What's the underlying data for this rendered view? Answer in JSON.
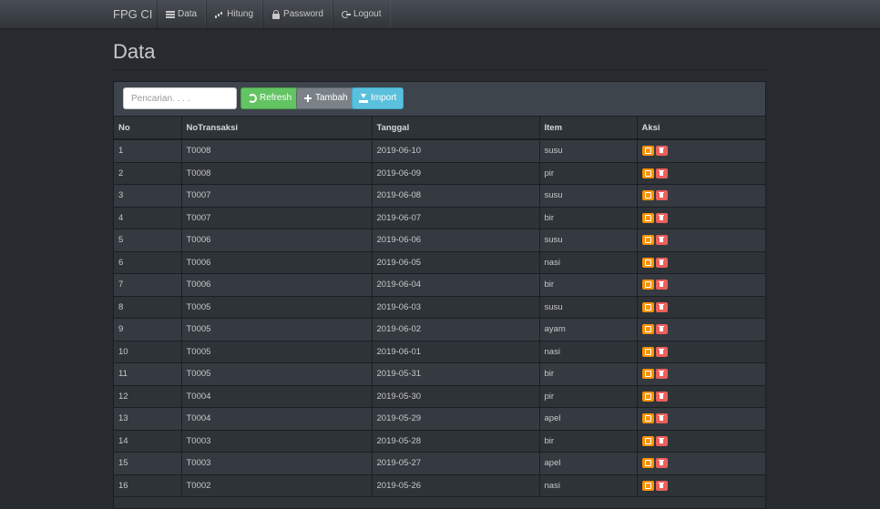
{
  "navbar": {
    "brand": "FPG CI",
    "items": [
      {
        "label": "Data",
        "icon": "list-icon"
      },
      {
        "label": "Hitung",
        "icon": "signal-icon"
      },
      {
        "label": "Password",
        "icon": "lock-icon"
      },
      {
        "label": "Logout",
        "icon": "logout-icon"
      }
    ]
  },
  "page": {
    "title": "Data"
  },
  "toolbar": {
    "search_placeholder": "Pencarian. . . .",
    "refresh_label": "Refresh",
    "tambah_label": "Tambah",
    "import_label": "Import"
  },
  "table": {
    "headers": [
      "No",
      "NoTransaksi",
      "Tanggal",
      "Item",
      "Aksi"
    ],
    "rows": [
      {
        "no": "1",
        "trx": "T0008",
        "date": "2019-06-10",
        "item": "susu"
      },
      {
        "no": "2",
        "trx": "T0008",
        "date": "2019-06-09",
        "item": "pir"
      },
      {
        "no": "3",
        "trx": "T0007",
        "date": "2019-06-08",
        "item": "susu"
      },
      {
        "no": "4",
        "trx": "T0007",
        "date": "2019-06-07",
        "item": "bir"
      },
      {
        "no": "5",
        "trx": "T0006",
        "date": "2019-06-06",
        "item": "susu"
      },
      {
        "no": "6",
        "trx": "T0006",
        "date": "2019-06-05",
        "item": "nasi"
      },
      {
        "no": "7",
        "trx": "T0006",
        "date": "2019-06-04",
        "item": "bir"
      },
      {
        "no": "8",
        "trx": "T0005",
        "date": "2019-06-03",
        "item": "susu"
      },
      {
        "no": "9",
        "trx": "T0005",
        "date": "2019-06-02",
        "item": "ayam"
      },
      {
        "no": "10",
        "trx": "T0005",
        "date": "2019-06-01",
        "item": "nasi"
      },
      {
        "no": "11",
        "trx": "T0005",
        "date": "2019-05-31",
        "item": "bir"
      },
      {
        "no": "12",
        "trx": "T0004",
        "date": "2019-05-30",
        "item": "pir"
      },
      {
        "no": "13",
        "trx": "T0004",
        "date": "2019-05-29",
        "item": "apel"
      },
      {
        "no": "14",
        "trx": "T0003",
        "date": "2019-05-28",
        "item": "bir"
      },
      {
        "no": "15",
        "trx": "T0003",
        "date": "2019-05-27",
        "item": "apel"
      },
      {
        "no": "16",
        "trx": "T0002",
        "date": "2019-05-26",
        "item": "nasi"
      }
    ]
  },
  "colors": {
    "background": "#272b30",
    "edit": "#f89406",
    "delete": "#ee5f5b",
    "refresh": "#62c462",
    "import": "#5bc0de"
  }
}
